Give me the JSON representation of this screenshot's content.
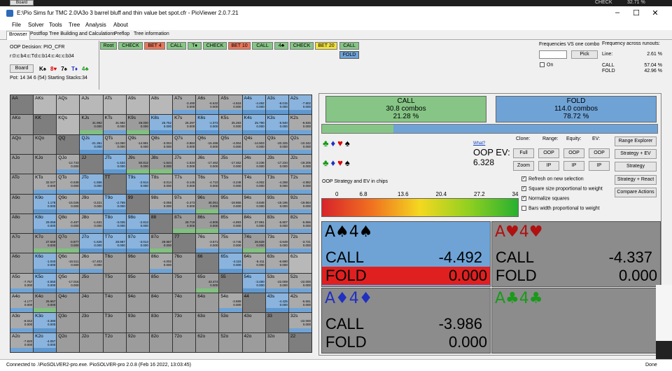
{
  "topstrip": {
    "left_btn": "Board",
    "label": "CHECK",
    "value": "32.71 %"
  },
  "window": {
    "title": "E:\\Pio Sims fur TMC 2.0\\A3o 3 barrel bluff and thin value bet spot.cfr - PioViewer 2.0.7.21",
    "minimize": "–",
    "maximize": "☐",
    "close": "✕"
  },
  "menu": [
    "File",
    "Solver",
    "Tools",
    "Tree",
    "Analysis",
    "About"
  ],
  "tabs": [
    "Browser",
    "Postflop Tree Building and Calculations",
    "Preflop",
    "Tree information"
  ],
  "info": {
    "decision": "OOP Decision:   PIO_CFR",
    "board_code": "r:0:c:b4:c:Td:c:b14:c:4c:c:b34",
    "board_btn": "Board",
    "board_cards": [
      {
        "t": "K♠",
        "c": "#000"
      },
      {
        "t": "8♥",
        "c": "#d00"
      },
      {
        "t": "7♠",
        "c": "#000"
      },
      {
        "t": "T♦",
        "c": "#2030c0"
      },
      {
        "t": "4♣",
        "c": "#1a9a1a"
      }
    ],
    "pot": "Pot: 14 34 6 (54) Starting Stacks:34"
  },
  "path": [
    {
      "label": "Root",
      "color": "#86c586"
    },
    {
      "label": "CHECK",
      "color": "#86c586"
    },
    {
      "label": "BET 4",
      "color": "#e8765a"
    },
    {
      "label": "CALL",
      "color": "#86c586"
    },
    {
      "label": "T♦",
      "color": "#86c586"
    },
    {
      "label": "CHECK",
      "color": "#86c586"
    },
    {
      "label": "BET 10",
      "color": "#e8765a"
    },
    {
      "label": "CALL",
      "color": "#86c586"
    },
    {
      "label": "4♣",
      "color": "#86c586"
    },
    {
      "label": "CHECK",
      "color": "#86c586"
    },
    {
      "label": "BET 20",
      "color": "#f0e040"
    },
    {
      "label": "CALL",
      "color": "#86c586"
    }
  ],
  "fold_btn": "FOLD",
  "freq_vs": {
    "title": "Frequencies VS one combo",
    "pick": "Pick",
    "on": "On"
  },
  "freq_runouts": {
    "title": "Frequency across runouts:",
    "line_label": "Line:",
    "line_val": "2.61 %",
    "call_label": "CALL",
    "call_val": "57.04 %",
    "fold_label": "FOLD",
    "fold_val": "42.96 %"
  },
  "grid": [
    [
      [
        "AA",
        "",
        ""
      ],
      [
        "AKs",
        "",
        ""
      ],
      [
        "AQs",
        "",
        ""
      ],
      [
        "AJs",
        "",
        ""
      ],
      [
        "ATs",
        "",
        ""
      ],
      [
        "A9s",
        "",
        ""
      ],
      [
        "A8s",
        "",
        ""
      ],
      [
        "A7s",
        "-3.490",
        "0.000"
      ],
      [
        "A6s",
        "-6.632",
        "0.000"
      ],
      [
        "A5s",
        "-4.818",
        "0.000"
      ],
      [
        "A4s",
        "-4.492",
        "0.000"
      ],
      [
        "A3s",
        "-8.015",
        "0.000"
      ],
      [
        "A2s",
        "-7.802",
        "0.000"
      ]
    ],
    [
      [
        "AKo",
        "",
        ""
      ],
      [
        "KK",
        "",
        ""
      ],
      [
        "KQs",
        "",
        ""
      ],
      [
        "KJs",
        "31.992",
        "0.000"
      ],
      [
        "KTs",
        "31.992",
        "0.000"
      ],
      [
        "K9s",
        "29.000",
        "0.000"
      ],
      [
        "K8s",
        "25.752",
        "0.000"
      ],
      [
        "K7s",
        "26.297",
        "0.000"
      ],
      [
        "K6s",
        "-1.073",
        "0.000"
      ],
      [
        "K5s",
        "25.283",
        "0.000"
      ],
      [
        "K4s",
        "25.780",
        "0.000"
      ],
      [
        "K3s",
        "-5.940",
        "0.000"
      ],
      [
        "K2s",
        "-6.845",
        "0.000"
      ]
    ],
    [
      [
        "AQo",
        "",
        ""
      ],
      [
        "KQo",
        "",
        ""
      ],
      [
        "QQ",
        "",
        ""
      ],
      [
        "QJs",
        "-21.351",
        "0.000"
      ],
      [
        "QTs",
        "-12.050",
        "0.000"
      ],
      [
        "Q9s",
        "-14.991",
        "0.000"
      ],
      [
        "Q8s",
        "-3.004",
        "0.000"
      ],
      [
        "Q7s",
        "-3.884",
        "0.000"
      ],
      [
        "Q6s",
        "-15.486",
        "0.000"
      ],
      [
        "Q5s",
        "-4.004",
        "0.000"
      ],
      [
        "Q4s",
        "-14.903",
        "0.000"
      ],
      [
        "Q3s",
        "-20.325",
        "0.000"
      ],
      [
        "Q2s",
        "-10.342",
        "0.000"
      ]
    ],
    [
      [
        "AJo",
        "",
        ""
      ],
      [
        "KJo",
        "",
        ""
      ],
      [
        "QJo",
        "-12.733",
        "0.000"
      ],
      [
        "JJ",
        "",
        ""
      ],
      [
        "JTs",
        "-1.534",
        "0.000"
      ],
      [
        "J9s",
        "50.812",
        "0.000"
      ],
      [
        "J8s",
        "-1.644",
        "0.000"
      ],
      [
        "J7s",
        "-1.634",
        "0.000"
      ],
      [
        "J6s",
        "-17.462",
        "0.000"
      ],
      [
        "J5s",
        "-17.462",
        "0.000"
      ],
      [
        "J4s",
        "-2.236",
        "0.000"
      ],
      [
        "J3s",
        "-17.234",
        "0.000"
      ],
      [
        "J2s",
        "-19.205",
        "0.000"
      ]
    ],
    [
      [
        "ATo",
        "",
        ""
      ],
      [
        "KTo",
        "32.047",
        "0.000"
      ],
      [
        "QTo",
        "-0.638",
        "0.000"
      ],
      [
        "JTo",
        "-1.556",
        "0.000"
      ],
      [
        "TT",
        "",
        ""
      ],
      [
        "T9s",
        "-2.914",
        "0.000"
      ],
      [
        "T8s",
        "-3.014",
        "0.000"
      ],
      [
        "T7s",
        "-3.145",
        "0.000"
      ],
      [
        "T6s",
        "-4.710",
        "0.000"
      ],
      [
        "T5s",
        "-3.248",
        "0.000"
      ],
      [
        "T4s",
        "-4.002",
        "0.000"
      ],
      [
        "T3s",
        "-4.258",
        "0.000"
      ],
      [
        "T2s",
        "-4.852",
        "0.000"
      ]
    ],
    [
      [
        "A9o",
        "",
        ""
      ],
      [
        "K9o",
        "1.178",
        "0.000"
      ],
      [
        "Q9o",
        "-15.026",
        "0.000"
      ],
      [
        "J9o",
        "-3.221",
        "0.000"
      ],
      [
        "T9o",
        "-2.759",
        "0.000"
      ],
      [
        "99",
        "",
        ""
      ],
      [
        "98s",
        "-3.055",
        "0.000"
      ],
      [
        "97s",
        "-2.473",
        "0.000"
      ],
      [
        "96s",
        "45.061",
        "0.000"
      ],
      [
        "95s",
        "-19.866",
        "0.000"
      ],
      [
        "94s",
        "-3.848",
        "0.000"
      ],
      [
        "93s",
        "-19.196",
        "0.000"
      ],
      [
        "92s",
        "-19.864",
        "0.000"
      ]
    ],
    [
      [
        "A8o",
        "",
        ""
      ],
      [
        "K8o",
        "29.059",
        "0.000"
      ],
      [
        "Q8o",
        "-3.487",
        "0.000"
      ],
      [
        "J8o",
        "-1.631",
        "0.000"
      ],
      [
        "T8o",
        "-3.035",
        "0.000"
      ],
      [
        "98o",
        "-2.813",
        "0.000"
      ],
      [
        "88",
        "",
        ""
      ],
      [
        "87s",
        "28.719",
        "0.000"
      ],
      [
        "86s",
        "-4.805",
        "0.000"
      ],
      [
        "85s",
        "-4.893",
        "0.000"
      ],
      [
        "84s",
        "27.991",
        "0.000"
      ],
      [
        "83s",
        "-5.807",
        "0.000"
      ],
      [
        "82s",
        "-5.866",
        "0.000"
      ]
    ],
    [
      [
        "A7o",
        "",
        ""
      ],
      [
        "K7o",
        "27.559",
        "0.000"
      ],
      [
        "Q7o",
        "-3.877",
        "0.000"
      ],
      [
        "J7o",
        "-1.626",
        "0.000"
      ],
      [
        "T7o",
        "28.987",
        "0.000"
      ],
      [
        "97o",
        "-3.014",
        "0.000"
      ],
      [
        "87o",
        "28.987",
        "0.000"
      ],
      [
        "77",
        "",
        ""
      ],
      [
        "76s",
        "-3.571",
        "0.000"
      ],
      [
        "75s",
        "-3.745",
        "0.000"
      ],
      [
        "74s",
        "26.628",
        "0.000"
      ],
      [
        "73s",
        "-3.649",
        "0.000"
      ],
      [
        "72s",
        "-3.721",
        "0.000"
      ]
    ],
    [
      [
        "A6o",
        "",
        ""
      ],
      [
        "K6o",
        "-1.040",
        "0.000"
      ],
      [
        "Q6o",
        "-16.511",
        "0.000"
      ],
      [
        "J6o",
        "-17.403",
        "0.000"
      ],
      [
        "T6o",
        "",
        ""
      ],
      [
        "96o",
        "",
        ""
      ],
      [
        "86o",
        "-4.002",
        "0.000"
      ],
      [
        "76o",
        "",
        ""
      ],
      [
        "66",
        "",
        ""
      ],
      [
        "65s",
        "-4.115",
        "0.000"
      ],
      [
        "64s",
        "-5.411",
        "0.000"
      ],
      [
        "63s",
        "-6.690",
        "0.000"
      ],
      [
        "62s",
        "",
        ""
      ]
    ],
    [
      [
        "A5o",
        "-7.757",
        "0.000"
      ],
      [
        "K5o",
        "-2.550",
        "0.000"
      ],
      [
        "Q5o",
        "-17.016",
        "0.000"
      ],
      [
        "J5o",
        "",
        ""
      ],
      [
        "T5o",
        "",
        ""
      ],
      [
        "95o",
        "",
        ""
      ],
      [
        "85o",
        "",
        ""
      ],
      [
        "75o",
        "",
        ""
      ],
      [
        "65o",
        "43.474",
        "0.000"
      ],
      [
        "55",
        "",
        ""
      ],
      [
        "54s",
        "-3.490",
        "0.000"
      ],
      [
        "53s",
        "-22.009",
        "0.000"
      ],
      [
        "52s",
        "-22.000",
        "0.000"
      ]
    ],
    [
      [
        "A4o",
        "-4.177",
        "0.000"
      ],
      [
        "K4o",
        "25.967",
        "0.000"
      ],
      [
        "Q4o",
        "",
        ""
      ],
      [
        "J4o",
        "",
        ""
      ],
      [
        "T4o",
        "",
        ""
      ],
      [
        "94o",
        "",
        ""
      ],
      [
        "84o",
        "",
        ""
      ],
      [
        "74o",
        "",
        ""
      ],
      [
        "64o",
        "",
        ""
      ],
      [
        "54o",
        "-3.889",
        "0.000"
      ],
      [
        "44",
        "",
        ""
      ],
      [
        "43s",
        "-4.425",
        "0.000"
      ],
      [
        "42s",
        "-5.661",
        "0.000"
      ]
    ],
    [
      [
        "A3o",
        "-8.042",
        "0.000"
      ],
      [
        "K3o",
        "-3.380",
        "0.000"
      ],
      [
        "Q3o",
        "",
        ""
      ],
      [
        "J3o",
        "",
        ""
      ],
      [
        "T3o",
        "",
        ""
      ],
      [
        "93o",
        "",
        ""
      ],
      [
        "83o",
        "",
        ""
      ],
      [
        "73o",
        "",
        ""
      ],
      [
        "63o",
        "",
        ""
      ],
      [
        "53o",
        "",
        ""
      ],
      [
        "43o",
        "",
        ""
      ],
      [
        "33",
        "",
        ""
      ],
      [
        "32s",
        "-22.000",
        "0.000"
      ]
    ],
    [
      [
        "A2o",
        "-7.820",
        "0.000"
      ],
      [
        "K2o",
        "-4.057",
        "0.000"
      ],
      [
        "Q2o",
        "",
        ""
      ],
      [
        "J2o",
        "",
        ""
      ],
      [
        "T2o",
        "",
        ""
      ],
      [
        "92o",
        "",
        ""
      ],
      [
        "82o",
        "",
        ""
      ],
      [
        "72o",
        "",
        ""
      ],
      [
        "62o",
        "",
        ""
      ],
      [
        "52o",
        "",
        ""
      ],
      [
        "42o",
        "",
        ""
      ],
      [
        "32o",
        "",
        ""
      ],
      [
        "22",
        "",
        ""
      ]
    ]
  ],
  "summary": {
    "call_label": "CALL",
    "call_combos": "30.8 combos",
    "call_pct": "21.28 %",
    "fold_label": "FOLD",
    "fold_combos": "114.0 combos",
    "fold_pct": "78.72 %",
    "call_fraction": 0.2128
  },
  "suits_row1": [
    {
      "t": "♣",
      "c": "#1a9a1a"
    },
    {
      "t": "♦",
      "c": "#2030c0"
    },
    {
      "t": "♥",
      "c": "#d00"
    },
    {
      "t": "♠",
      "c": "#000"
    }
  ],
  "suits_row2": [
    {
      "t": "♣",
      "c": "#1a9a1a"
    },
    {
      "t": "♦",
      "c": "#2030c0"
    },
    {
      "t": "♥",
      "c": "#d00"
    },
    {
      "t": "♠",
      "c": "#000"
    }
  ],
  "ev": {
    "what": "What?",
    "label": "OOP EV:",
    "value": "6.328"
  },
  "controls": {
    "clone": "Clone:",
    "range": "Range:",
    "equity": "Equity:",
    "ev": "EV:",
    "full": "Full",
    "zoom": "Zoom",
    "oop1": "OOP",
    "ip1": "IP",
    "oop2": "OOP",
    "ip2": "IP",
    "oop3": "OOP",
    "ip3": "IP",
    "range_explorer": "Range Explorer",
    "strategy_ev": "Strategy + EV",
    "strategy": "Strategy",
    "strategy_react": "Strategy + React",
    "compare": "Compare Actions"
  },
  "checks": [
    {
      "label": "Refresh on new selection",
      "on": true
    },
    {
      "label": "Square size proportional to weight",
      "on": true
    },
    {
      "label": "Normalize squares",
      "on": true
    },
    {
      "label": "Bars width proportional to weight",
      "on": false
    }
  ],
  "gradient": {
    "title": "OOP Strategy and EV in chips",
    "ticks": [
      "0",
      "6.8",
      "13.6",
      "20.4",
      "27.2",
      "34"
    ]
  },
  "combos": [
    {
      "name": "A♠4♠",
      "name_color": "#000",
      "bg": "#6fa3d6",
      "call": "-4.492",
      "fold": "0.000",
      "fold_bg": "#e02020"
    },
    {
      "name": "A♥4♥",
      "name_color": "#b01010",
      "bg": "#8c8c8c",
      "call": "-4.337",
      "fold": "0.000",
      "fold_bg": "#8c8c8c"
    },
    {
      "name": "A♦4♦",
      "name_color": "#2030c0",
      "bg": "#8c8c8c",
      "call": "-3.986",
      "fold": "0.000",
      "fold_bg": "#8c8c8c"
    },
    {
      "name": "A♣4♣",
      "name_color": "#1a9a1a",
      "bg": "#8c8c8c",
      "call": "",
      "fold": "",
      "fold_bg": "#8c8c8c"
    }
  ],
  "status": {
    "left": "Connected to .\\PioSOLVER2-pro.exe. PioSOLVER-pro 2.0.8 (Feb 16 2022, 13:03:45)",
    "right": "Done"
  }
}
